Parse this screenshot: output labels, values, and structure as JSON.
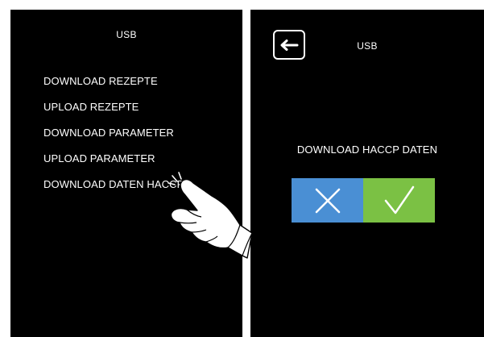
{
  "left_screen": {
    "title": "USB",
    "menu_items": [
      "DOWNLOAD REZEPTE",
      "UPLOAD REZEPTE",
      "DOWNLOAD PARAMETER",
      "UPLOAD PARAMETER",
      "DOWNLOAD DATEN HACCP"
    ]
  },
  "right_screen": {
    "title": "USB",
    "dialog_text": "DOWNLOAD HACCP DATEN",
    "back_icon": "arrow-left-icon",
    "cancel_icon": "x-icon",
    "confirm_icon": "checkmark-icon"
  },
  "colors": {
    "screen_background": "#000000",
    "cancel_button": "#4a8fd4",
    "confirm_button": "#7bc144"
  }
}
